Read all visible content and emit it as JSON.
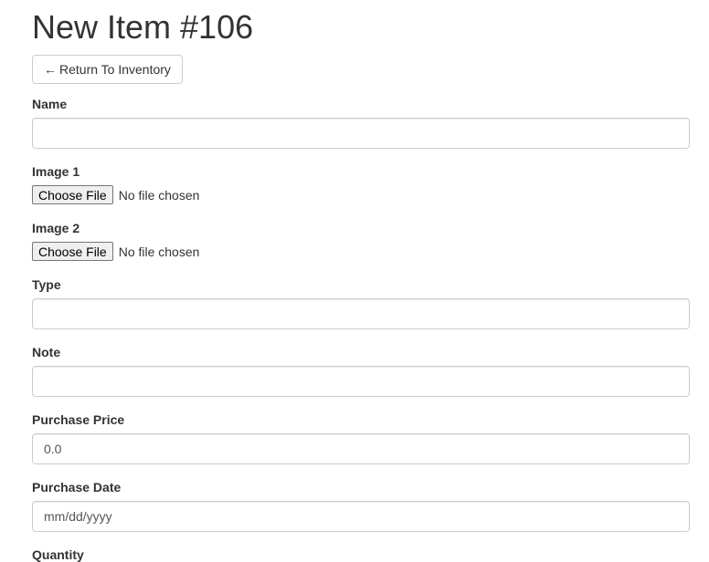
{
  "header": {
    "title": "New Item #106",
    "back_arrow": "←",
    "back_label": "Return To Inventory"
  },
  "form": {
    "name": {
      "label": "Name",
      "value": ""
    },
    "image1": {
      "label": "Image 1",
      "button": "Choose File",
      "status": "No file chosen"
    },
    "image2": {
      "label": "Image 2",
      "button": "Choose File",
      "status": "No file chosen"
    },
    "type": {
      "label": "Type",
      "value": ""
    },
    "note": {
      "label": "Note",
      "value": ""
    },
    "purchase_price": {
      "label": "Purchase Price",
      "value": "0.0"
    },
    "purchase_date": {
      "label": "Purchase Date",
      "placeholder": "mm/dd/yyyy"
    },
    "quantity": {
      "label": "Quantity"
    }
  }
}
